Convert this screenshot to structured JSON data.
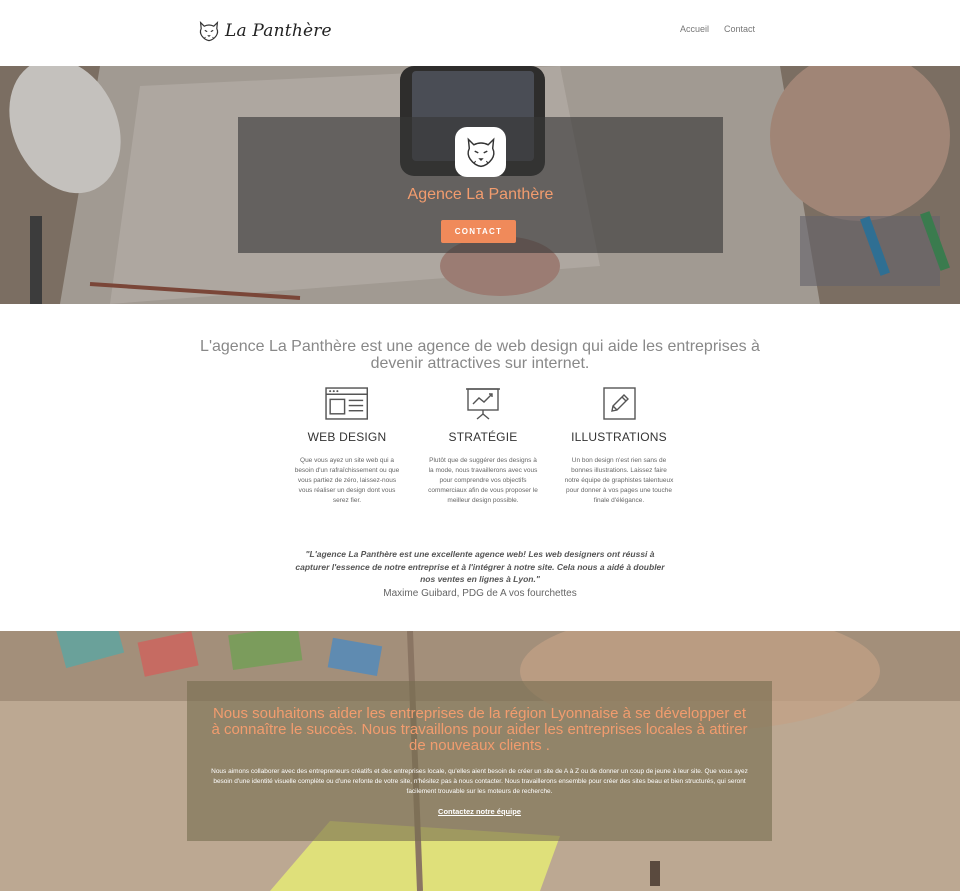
{
  "header": {
    "brand": "La Panthère",
    "nav": [
      {
        "label": "Accueil"
      },
      {
        "label": "Contact"
      }
    ]
  },
  "hero": {
    "title": "Agence La Panthère",
    "button_label": "CONTACT",
    "icon": "panther-head-icon"
  },
  "intro": {
    "text": "L'agence La Panthère est une agence de web design qui aide les entreprises à devenir attractives sur internet."
  },
  "services": [
    {
      "icon": "browser-window-icon",
      "title": "WEB DESIGN",
      "text": "Que vous ayez un site web qui a besoin d'un rafraîchissement ou que vous partiez de zéro, laissez-nous vous réaliser un design dont vous serez fier."
    },
    {
      "icon": "presentation-chart-icon",
      "title": "STRATÉGIE",
      "text": "Plutôt que de suggérer des designs à la mode, nous travaillerons avec vous pour comprendre vos objectifs commerciaux afin de vous proposer le meilleur design possible."
    },
    {
      "icon": "pencil-icon",
      "title": "ILLUSTRATIONS",
      "text": "Un bon design n'est rien sans de bonnes illustrations. Laissez faire notre équipe de graphistes talentueux pour donner à vos pages une touche finale d'élégance."
    }
  ],
  "testimonial": {
    "quote": "\"L'agence La Panthère est une excellente agence web! Les web designers ont réussi à capturer l'essence de notre entreprise et à l'intégrer à notre site. Cela nous a aidé à doubler nos ventes en lignes à Lyon.\"",
    "author": "Maxime Guibard, PDG de A vos fourchettes"
  },
  "cta": {
    "title": "Nous souhaitons aider les entreprises de la région Lyonnaise à se développer et à connaître le succès. Nous travaillons pour aider les entreprises locales à attirer de nouveaux clients .",
    "text": "Nous aimons collaborer avec des entrepreneurs créatifs et des entreprises locale, qu'elles aient besoin de créer un site de A à Z ou de donner un coup de jeune à leur site. Que vous ayez besoin d'une identité visuelle complète ou d'une refonte de votre site, n'hésitez pas à nous contacter. Nous travaillerons ensemble pour créer des sites beau et bien structurés, qui seront facilement trouvable sur les moteurs de recherche.",
    "link_label": "Contactez notre équipe"
  },
  "colors": {
    "accent": "#f08a5a",
    "accent_text": "#f29c6e"
  }
}
